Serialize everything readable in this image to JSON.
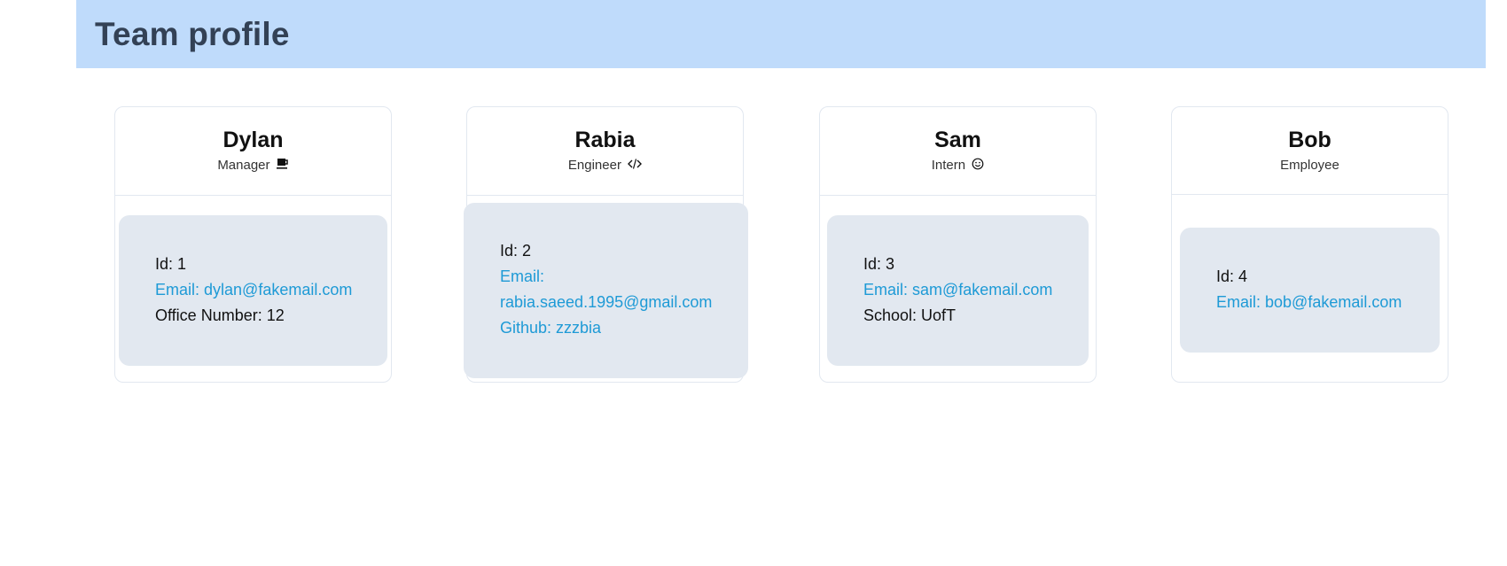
{
  "page": {
    "title": "Team profile"
  },
  "cards": [
    {
      "name": "Dylan",
      "role": "Manager",
      "role_icon": "coffee-icon",
      "id_label": "Id: 1",
      "email_label": "Email: dylan@fakemail.com",
      "extra_label": "Office Number: 12"
    },
    {
      "name": "Rabia",
      "role": "Engineer",
      "role_icon": "code-icon",
      "id_label": "Id: 2",
      "email_label_1": "Email:",
      "email_label_2": "rabia.saeed.1995@gmail.com",
      "extra_label": "Github: zzzbia"
    },
    {
      "name": "Sam",
      "role": "Intern",
      "role_icon": "smile-icon",
      "id_label": "Id: 3",
      "email_label": "Email: sam@fakemail.com",
      "extra_label": "School: UofT"
    },
    {
      "name": "Bob",
      "role": "Employee",
      "id_label": "Id: 4",
      "email_label": "Email: bob@fakemail.com"
    }
  ],
  "colors": {
    "header_bg": "#bfdbfb",
    "body_bg": "#e2e8f0",
    "link": "#1e9ad6",
    "title": "#334155"
  }
}
